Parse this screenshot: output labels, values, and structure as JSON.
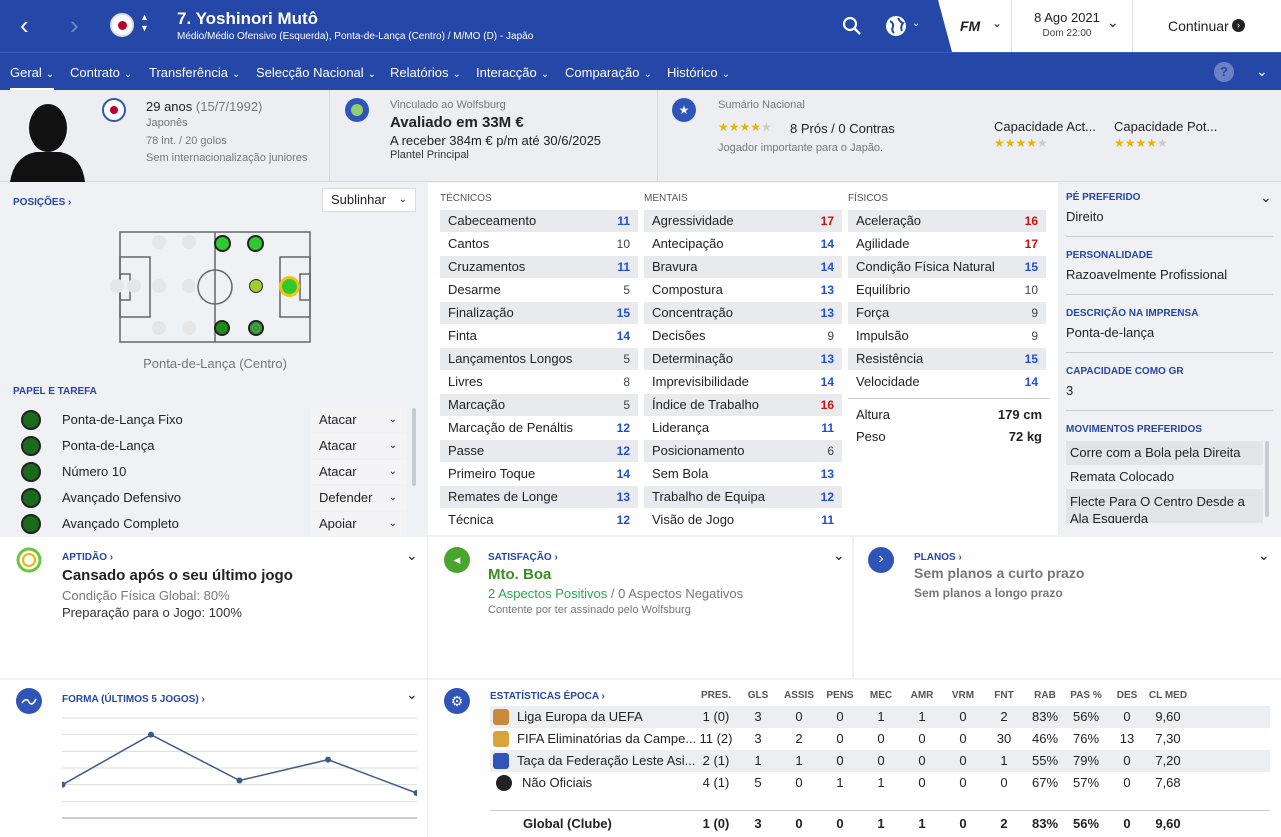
{
  "header": {
    "player_name": "7. Yoshinori Mutô",
    "positions_line": "Médio/Médio Ofensivo (Esquerda), Ponta-de-Lança (Centro) / M/MO (D) - Japão",
    "date": "8 Ago 2021",
    "day_time": "Dom 22:00",
    "continue_label": "Continuar",
    "fm_label": "FM"
  },
  "tabs": [
    {
      "label": "Geral"
    },
    {
      "label": "Contrato"
    },
    {
      "label": "Transferência"
    },
    {
      "label": "Selecção Nacional"
    },
    {
      "label": "Relatórios"
    },
    {
      "label": "Interacção"
    },
    {
      "label": "Comparação"
    },
    {
      "label": "Histórico"
    }
  ],
  "info": {
    "age": "29 anos",
    "dob": "(15/7/1992)",
    "nationality": "Japonês",
    "caps": "78 int. / 20 golos",
    "youth": "Sem internacionalização juniores",
    "club_label": "Vinculado ao Wolfsburg",
    "value": "Avaliado em 33M €",
    "wage": "A receber 384m € p/m até 30/6/2025",
    "squad": "Plantel Principal",
    "national_summary": "Sumário Nacional",
    "pros_cons": "8 Prós / 0 Contras",
    "importance": "Jogador importante para o Japão.",
    "current_ability": "Capacidade Act...",
    "potential_ability": "Capacidade Pot..."
  },
  "positions": {
    "title": "POSIÇÕES",
    "highlight": "Sublinhar",
    "position_label": "Ponta-de-Lança (Centro)",
    "roles_title": "PAPEL E TAREFA",
    "roles": [
      {
        "name": "Ponta-de-Lança Fixo",
        "duty": "Atacar"
      },
      {
        "name": "Ponta-de-Lança",
        "duty": "Atacar"
      },
      {
        "name": "Número 10",
        "duty": "Atacar"
      },
      {
        "name": "Avançado Defensivo",
        "duty": "Defender"
      },
      {
        "name": "Avançado Completo",
        "duty": "Apoiar"
      }
    ]
  },
  "attributes": {
    "tech_title": "TÉCNICOS",
    "ment_title": "MENTAIS",
    "phys_title": "FÍSICOS",
    "technical": [
      {
        "n": "Cabeceamento",
        "v": "11",
        "c": "b"
      },
      {
        "n": "Cantos",
        "v": "10",
        "c": "n"
      },
      {
        "n": "Cruzamentos",
        "v": "11",
        "c": "b"
      },
      {
        "n": "Desarme",
        "v": "5",
        "c": "n"
      },
      {
        "n": "Finalização",
        "v": "15",
        "c": "b"
      },
      {
        "n": "Finta",
        "v": "14",
        "c": "b"
      },
      {
        "n": "Lançamentos Longos",
        "v": "5",
        "c": "n"
      },
      {
        "n": "Livres",
        "v": "8",
        "c": "n"
      },
      {
        "n": "Marcação",
        "v": "5",
        "c": "n"
      },
      {
        "n": "Marcação de Penáltis",
        "v": "12",
        "c": "b"
      },
      {
        "n": "Passe",
        "v": "12",
        "c": "b"
      },
      {
        "n": "Primeiro Toque",
        "v": "14",
        "c": "b"
      },
      {
        "n": "Remates de Longe",
        "v": "13",
        "c": "b"
      },
      {
        "n": "Técnica",
        "v": "12",
        "c": "b"
      }
    ],
    "mental": [
      {
        "n": "Agressividade",
        "v": "17",
        "c": "r"
      },
      {
        "n": "Antecipação",
        "v": "14",
        "c": "b"
      },
      {
        "n": "Bravura",
        "v": "14",
        "c": "b"
      },
      {
        "n": "Compostura",
        "v": "13",
        "c": "b"
      },
      {
        "n": "Concentração",
        "v": "13",
        "c": "b"
      },
      {
        "n": "Decisões",
        "v": "9",
        "c": "n"
      },
      {
        "n": "Determinação",
        "v": "13",
        "c": "b"
      },
      {
        "n": "Imprevisibilidade",
        "v": "14",
        "c": "b"
      },
      {
        "n": "Índice de Trabalho",
        "v": "16",
        "c": "r"
      },
      {
        "n": "Liderança",
        "v": "11",
        "c": "b"
      },
      {
        "n": "Posicionamento",
        "v": "6",
        "c": "n"
      },
      {
        "n": "Sem Bola",
        "v": "13",
        "c": "b"
      },
      {
        "n": "Trabalho de Equipa",
        "v": "12",
        "c": "b"
      },
      {
        "n": "Visão de Jogo",
        "v": "11",
        "c": "b"
      }
    ],
    "physical": [
      {
        "n": "Aceleração",
        "v": "16",
        "c": "r"
      },
      {
        "n": "Agilidade",
        "v": "17",
        "c": "r"
      },
      {
        "n": "Condição Física Natural",
        "v": "15",
        "c": "b"
      },
      {
        "n": "Equilíbrio",
        "v": "10",
        "c": "n"
      },
      {
        "n": "Força",
        "v": "9",
        "c": "n"
      },
      {
        "n": "Impulsão",
        "v": "9",
        "c": "n"
      },
      {
        "n": "Resistência",
        "v": "15",
        "c": "b"
      },
      {
        "n": "Velocidade",
        "v": "14",
        "c": "b"
      }
    ],
    "height_label": "Altura",
    "height": "179 cm",
    "weight_label": "Peso",
    "weight": "72 kg"
  },
  "side": {
    "foot_title": "PÉ PREFERIDO",
    "foot": "Direito",
    "personality_title": "PERSONALIDADE",
    "personality": "Razoavelmente Profissional",
    "media_title": "DESCRIÇÃO NA IMPRENSA",
    "media": "Ponta-de-lança",
    "gk_title": "CAPACIDADE COMO GR",
    "gk": "3",
    "moves_title": "MOVIMENTOS PREFERIDOS",
    "moves": [
      "Corre com a Bola pela Direita",
      "Remata Colocado",
      "Flecte Para O Centro Desde a Ala Esquerda"
    ]
  },
  "fitness": {
    "title": "APTIDÃO",
    "headline": "Cansado após o seu último jogo",
    "line1": "Condição Física Global: 80%",
    "line2": "Preparação para o Jogo: 100%"
  },
  "happiness": {
    "title": "SATISFAÇÃO",
    "headline": "Mto. Boa",
    "positives": "2 Aspectos Positivos",
    "sep": "/",
    "negatives": "0 Aspectos Negativos",
    "note": "Contente por ter assinado pelo Wolfsburg"
  },
  "plans": {
    "title": "PLANOS",
    "short": "Sem planos a curto prazo",
    "long": "Sem planos a longo prazo"
  },
  "form": {
    "title": "FORMA (ÚLTIMOS 5 JOGOS)",
    "points": [
      6.6,
      7.8,
      6.7,
      7.2,
      6.4
    ]
  },
  "season": {
    "title": "ESTATÍSTICAS ÉPOCA",
    "headers": [
      "PRES.",
      "GLS",
      "ASSIS",
      "PENS",
      "MEC",
      "AMR",
      "VRM",
      "FNT",
      "RAB",
      "PAS %",
      "DES",
      "CL MED"
    ],
    "rows": [
      {
        "comp": "Liga Europa da UEFA",
        "vals": [
          "1 (0)",
          "3",
          "0",
          "0",
          "1",
          "1",
          "0",
          "2",
          "83%",
          "56%",
          "0",
          "9,60"
        ]
      },
      {
        "comp": "FIFA Eliminatórias da Campe...",
        "vals": [
          "11 (2)",
          "3",
          "2",
          "0",
          "0",
          "0",
          "0",
          "30",
          "46%",
          "76%",
          "13",
          "7,30"
        ]
      },
      {
        "comp": "Taça da Federação Leste Asi...",
        "vals": [
          "2 (1)",
          "1",
          "1",
          "0",
          "0",
          "0",
          "0",
          "1",
          "55%",
          "79%",
          "0",
          "7,20"
        ]
      },
      {
        "comp": "Não Oficiais",
        "vals": [
          "4 (1)",
          "5",
          "0",
          "1",
          "1",
          "0",
          "0",
          "0",
          "67%",
          "57%",
          "0",
          "7,68"
        ]
      }
    ],
    "total": {
      "comp": "Global (Clube)",
      "vals": [
        "1 (0)",
        "3",
        "0",
        "0",
        "1",
        "1",
        "0",
        "2",
        "83%",
        "56%",
        "0",
        "9,60"
      ]
    }
  }
}
